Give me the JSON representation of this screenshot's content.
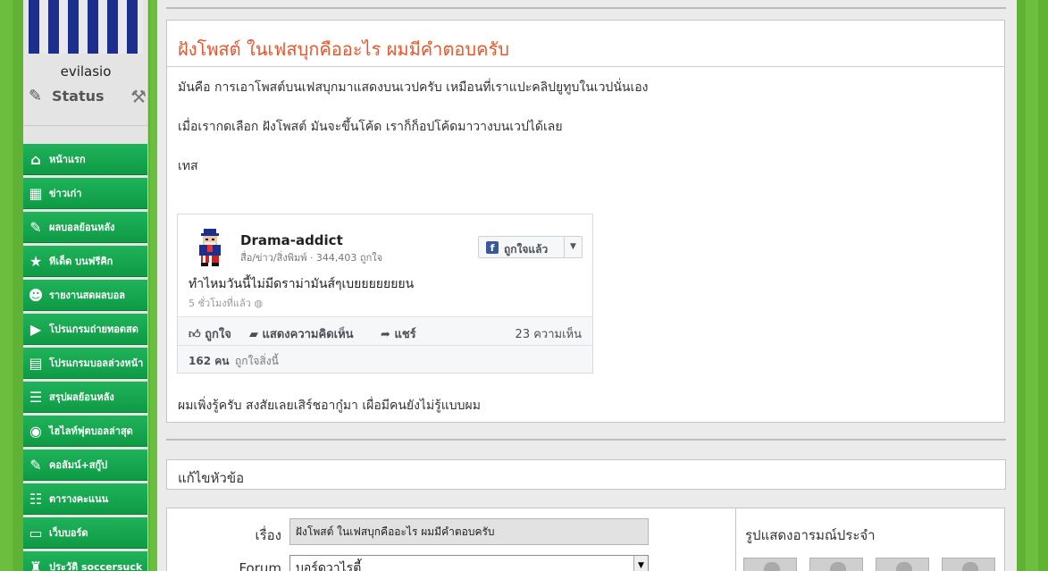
{
  "sidebar": {
    "username": "evilasio",
    "status_label": "Status",
    "menu": [
      {
        "label": "หน้าแรก",
        "icon": "home-icon",
        "glyph": "⌂"
      },
      {
        "label": "ข่าวเก่า",
        "icon": "table-icon",
        "glyph": "▦"
      },
      {
        "label": "ผลบอลย้อนหลัง",
        "icon": "notepad-icon",
        "glyph": "✎"
      },
      {
        "label": "ทีเด็ด บนฟรีคิก",
        "icon": "star-icon",
        "glyph": "★"
      },
      {
        "label": "รายงานสดผลบอล",
        "icon": "reporter-icon",
        "glyph": "☻"
      },
      {
        "label": "โปรแกรมถ่ายทอดสด",
        "icon": "video-camera-icon",
        "glyph": "▶"
      },
      {
        "label": "โปรแกรมบอลล่วงหน้า",
        "icon": "calendar-icon",
        "glyph": "▤"
      },
      {
        "label": "สรุปผลย้อนหลัง",
        "icon": "list-icon",
        "glyph": "☰"
      },
      {
        "label": "ไฮไลท์ฟุตบอลล่าสุด",
        "icon": "satellite-icon",
        "glyph": "◉"
      },
      {
        "label": "คอลัมน์+สกู๊ป",
        "icon": "notes-icon",
        "glyph": "✎"
      },
      {
        "label": "ตารางคะแนน",
        "icon": "scoreboard-icon",
        "glyph": "☷"
      },
      {
        "label": "เว็บบอร์ด",
        "icon": "monitor-icon",
        "glyph": "▭"
      },
      {
        "label": "ประวัติ soccersuck",
        "icon": "history-icon",
        "glyph": "♜"
      }
    ]
  },
  "post": {
    "title": "ฝังโพสต์ ในเฟสบุกคืออะไร ผมมีคำตอบครับ",
    "para1": "มันคือ การเอาโพสต์บนเฟสบุกมาแสดงบนเวปครับ เหมือนที่เราแปะคลิปยูทูบในเวปนั่นเอง",
    "para2": "เมื่อเรากดเลือก ฝังโพสต์ มันจะขึ้นโค้ด เราก็ก็อปโค้ดมาวางบนเวปได้เลย",
    "para3": "เทส",
    "para4": "ผมเพิ่งรู้ครับ สงสัยเลยเสิร์ชอากู๋มา เผื่อมีคนยังไม่รู้แบบผม"
  },
  "fb_embed": {
    "page_name": "Drama-addict",
    "category": "สื่อ/ข่าว/สิ่งพิมพ์ · 344,403 ถูกใจ",
    "liked_button": "ถูกใจแล้ว",
    "message": "ทำไหมวันนี้ไม่มีดราม่ามันส์ๆเบยยยยยยยน",
    "time": "5 ชั่วโมงที่แล้ว",
    "action_like": "ถูกใจ",
    "action_comment": "แสดงความคิดเห็น",
    "action_share": "แชร์",
    "comments": "23 ความเห็น",
    "likes_count": "162 คน",
    "likes_text": "ถูกใจสิ่งนี้"
  },
  "edit": {
    "title": "แก้ไขหัวข้อ",
    "subject_label": "เรื่อง",
    "subject_value": "ฝังโพสต์ ในเฟสบุกคืออะไร ผมมีคำตอบครับ",
    "forum_label": "Forum",
    "forum_value": "บอร์ดวาไรตี้",
    "emoticon_title": "รูปแสดงอารมณ์ประจำ"
  },
  "colors": {
    "menu_green": "#1fb35a",
    "title_orange": "#e8562a",
    "facebook_blue": "#3b5998"
  }
}
